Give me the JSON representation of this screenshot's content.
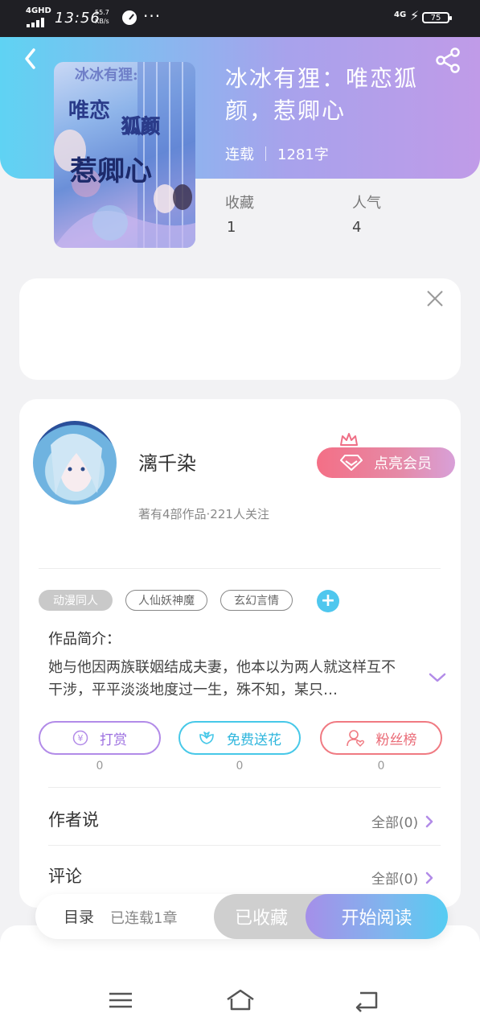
{
  "status_bar": {
    "network": "4GHD",
    "time": "13:56",
    "speed_value": "55.7",
    "speed_unit": "KB/s",
    "more": "···",
    "network2": "4G",
    "battery": "75"
  },
  "header": {
    "back_icon": "chevron-left-icon",
    "share_icon": "share-icon",
    "cover_title": "冰冰有狸：唯恋狐颜，惹卿心",
    "book_title": "冰冰有狸：唯恋狐颜，惹卿心",
    "status": "连载",
    "word_count": "1281字",
    "stats": [
      {
        "label": "收藏",
        "value": "1"
      },
      {
        "label": "人气",
        "value": "4"
      }
    ]
  },
  "author": {
    "name": "漓千染",
    "subtitle": "著有4部作品·221人关注",
    "vip_label": "点亮会员"
  },
  "tags": [
    "动漫同人",
    "人仙妖神魔",
    "玄幻言情"
  ],
  "intro": {
    "label": "作品简介：",
    "text": "她与他因两族联姻结成夫妻，他本以为两人就这样互不干涉，平平淡淡地度过一生，殊不知，某只…"
  },
  "actions": [
    {
      "label": "打赏",
      "count": "0",
      "icon": "yen-coin-icon"
    },
    {
      "label": "免费送花",
      "count": "0",
      "icon": "flower-icon"
    },
    {
      "label": "粉丝榜",
      "count": "0",
      "icon": "fan-person-icon"
    }
  ],
  "sections": [
    {
      "title": "作者说",
      "right": "全部(0)"
    },
    {
      "title": "评论",
      "right": "全部(0)"
    }
  ],
  "bottom": {
    "toc_label": "目录",
    "toc_status": "已连载1章",
    "fav_label": "已收藏",
    "read_label": "开始阅读"
  },
  "colors": {
    "header_start": "#5fd3f3",
    "header_end": "#c09be8",
    "accent_blue": "#4fc7ee",
    "accent_purple": "#9c6fe0",
    "accent_red": "#ea6a76"
  }
}
